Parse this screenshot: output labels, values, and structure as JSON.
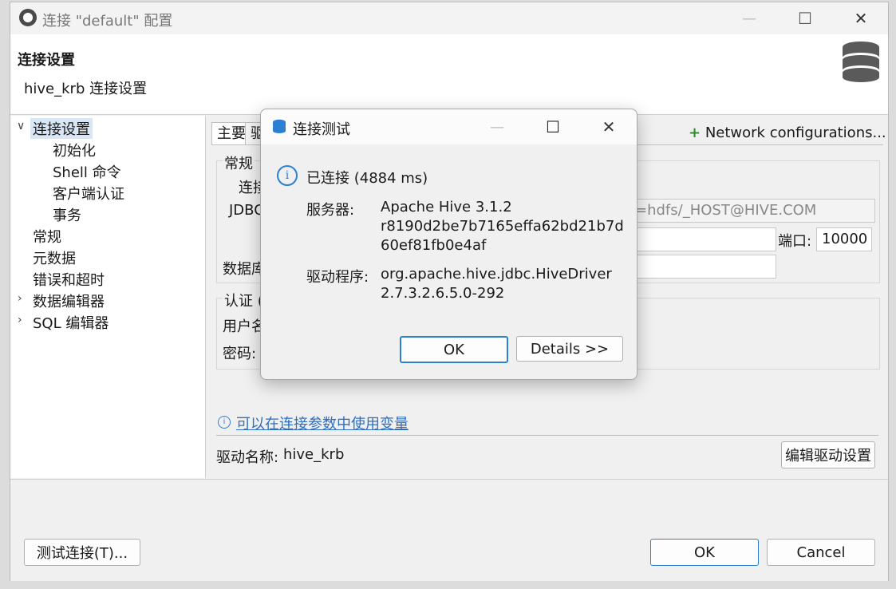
{
  "window": {
    "title": "连接 \"default\" 配置",
    "minimize": "—",
    "maximize": "☐",
    "close": "✕"
  },
  "header": {
    "title": "连接设置",
    "subtitle": "hive_krb 连接设置"
  },
  "sidebar": {
    "items": [
      {
        "label": "连接设置",
        "expanded": true
      },
      {
        "label": "初始化"
      },
      {
        "label": "Shell 命令"
      },
      {
        "label": "客户端认证"
      },
      {
        "label": "事务"
      },
      {
        "label": "常规"
      },
      {
        "label": "元数据"
      },
      {
        "label": "错误和超时"
      },
      {
        "label": "数据编辑器"
      },
      {
        "label": "SQL 编辑器"
      }
    ]
  },
  "content": {
    "tabs": [
      "主要",
      "驱"
    ],
    "network_config": "Network configurations...",
    "network_plus": "+",
    "general_group": "常规",
    "connect_label": "连接",
    "jdbc_label": "JDBC",
    "jdbc_url_visible": "=hdfs/_HOST@HIVE.COM",
    "port_label": "端口:",
    "port_value": "10000",
    "database_label": "数据库",
    "auth_group": "认证 (",
    "username_label": "用户名",
    "password_label": "密码:",
    "variables_link": "可以在连接参数中使用变量",
    "driver_name_label": "驱动名称:",
    "driver_name_value": "hive_krb",
    "edit_driver_button": "编辑驱动设置"
  },
  "footer": {
    "test_connection": "测试连接(T)...",
    "ok": "OK",
    "cancel": "Cancel"
  },
  "dialog": {
    "title": "连接测试",
    "status": "已连接 (4884 ms)",
    "server_label": "服务器:",
    "server_value_1": "Apache Hive 3.1.2",
    "server_value_2": "r8190d2be7b7165effa62bd21b7d",
    "server_value_3": "60ef81fb0e4af",
    "driver_label": "驱动程序:",
    "driver_value_1": "org.apache.hive.jdbc.HiveDriver",
    "driver_value_2": "2.7.3.2.6.5.0-292",
    "ok": "OK",
    "details": "Details >>"
  },
  "colors": {
    "accent": "#2d7fd3",
    "selection": "#d9e6f5",
    "link": "#2d6fc0"
  }
}
